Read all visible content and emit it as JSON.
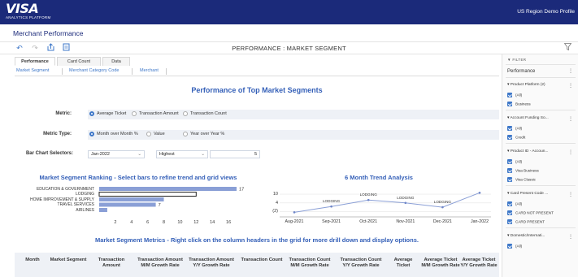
{
  "header": {
    "logo": "VISA",
    "logo_sub": "ANALYTICS PLATFORM",
    "profile": "US Region Demo Profile"
  },
  "page_title": "Merchant Performance",
  "toolbar": {
    "report_title": "PERFORMANCE : MARKET SEGMENT",
    "icons": [
      "undo-icon",
      "redo-icon",
      "share-icon",
      "export-icon",
      "filter-icon"
    ]
  },
  "tabs": [
    "Performance",
    "Card Count",
    "Data"
  ],
  "subtabs": [
    "Market Segment",
    "Merchant Category Code",
    "Merchant"
  ],
  "main_heading": "Performance of Top Market Segments",
  "selectors": {
    "metric_label": "Metric:",
    "metric_options": [
      "Average Ticket",
      "Transaction Amount",
      "Transaction Count"
    ],
    "metric_type_label": "Metric Type:",
    "metric_type_options": [
      "Month over Month %",
      "Value",
      "Year over Year %"
    ],
    "bar_label": "Bar Chart Selectors:",
    "period_value": "Jan-2022",
    "rank_value": "Highest",
    "count_value": "5"
  },
  "ranking_title": "Market Segment Ranking - Select bars to refine trend and grid views",
  "trend_title": "6 Month Trend Analysis",
  "metrics_title": "Market Segment Metrics - Right click on the column headers in the grid for more drill down and display options.",
  "chart_data": [
    {
      "type": "bar",
      "orientation": "horizontal",
      "title": "Market Segment Ranking - Select bars to refine trend and grid views",
      "categories": [
        "EDUCATION & GOVERNMENT",
        "LODGING",
        "HOME IMPROVEMENT & SUPPLY",
        "TRAVEL SERVICES",
        "AIRLINES"
      ],
      "values": [
        17,
        12,
        8,
        7,
        1
      ],
      "data_labels": [
        "17",
        "",
        "",
        "7",
        ""
      ],
      "selected": "LODGING",
      "xlim": [
        0,
        17.5
      ],
      "xticks": [
        "2",
        "4",
        "6",
        "8",
        "10",
        "12",
        "14",
        "16"
      ]
    },
    {
      "type": "line",
      "title": "6 Month Trend Analysis",
      "x": [
        "Aug-2021",
        "Sep-2021",
        "Oct-2021",
        "Nov-2021",
        "Dec-2021",
        "Jan-2022"
      ],
      "values": [
        -2.5,
        1.5,
        6.0,
        4.0,
        1.0,
        11.0
      ],
      "point_labels": [
        "",
        "LODGING",
        "LODGING",
        "LODGING",
        "LODGING",
        ""
      ],
      "yticks": [
        "10",
        "4",
        "(2)"
      ],
      "ylim": [
        -4,
        14
      ]
    }
  ],
  "grid": {
    "columns": [
      "Month",
      "Market Segment",
      "Transaction Amount",
      "Transaction Amount M/M Growth Rate",
      "Transaction Amount Y/Y Growth Rate",
      "Transaction Count",
      "Transaction Count M/M Growth Rate",
      "Transaction Count Y/Y Growth Rate",
      "Average Ticket",
      "Average Ticket M/M Growth Rate",
      "Average Ticket Y/Y Growth Rate"
    ]
  },
  "sidebar": {
    "filter_label": "FILTER",
    "heading": "Performance",
    "groups": [
      {
        "title": "Product Platform (2)",
        "items": [
          "(All)",
          "Business"
        ]
      },
      {
        "title": "Account Funding So...",
        "items": [
          "(All)",
          "Credit"
        ]
      },
      {
        "title": "Product ID - Accoun...",
        "items": [
          "(All)",
          "Visa Business",
          "Visa Classic"
        ]
      },
      {
        "title": "Card Present Code ...",
        "items": [
          "(All)",
          "CARD NOT PRESENT",
          "CARD PRESENT"
        ]
      },
      {
        "title": "Domestic/Internati...",
        "items": [
          "(All)"
        ]
      }
    ]
  },
  "colors": {
    "brand": "#1b2a7a",
    "accent": "#3d77c8",
    "bar": "#8a9fd6",
    "heading": "#3560b8"
  }
}
